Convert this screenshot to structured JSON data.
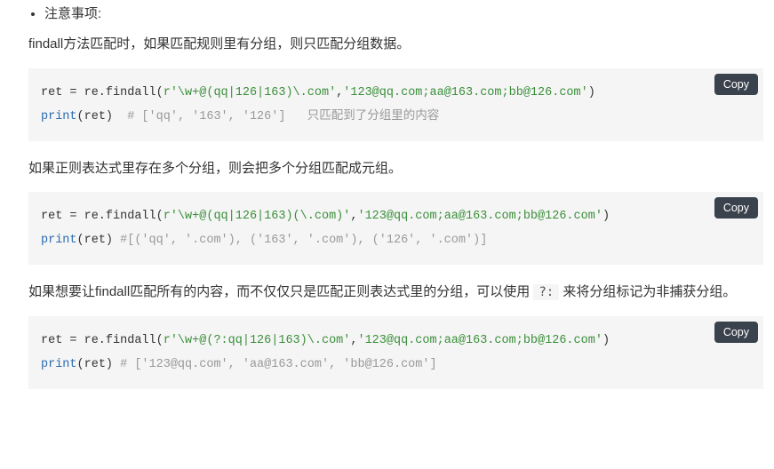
{
  "bullet": {
    "title": "注意事项:"
  },
  "para": {
    "p1": "findall方法匹配时，如果匹配规则里有分组，则只匹配分组数据。",
    "p2": "如果正则表达式里存在多个分组，则会把多个分组匹配成元组。",
    "p3a": "如果想要让findall匹配所有的内容，而不仅仅只是匹配正则表达式里的分组，可以使用 ",
    "p3b": " 来将分组标记为非捕获分组。",
    "inline_code": "?:"
  },
  "copy_label": "Copy",
  "code1": {
    "line1_a": "ret = re.findall(",
    "line1_s1": "r'\\w+@(qq|126|163)\\.com'",
    "line1_b": ",",
    "line1_s2": "'123@qq.com;aa@163.com;bb@126.com'",
    "line1_c": ")",
    "line2_a": "print",
    "line2_b": "(ret)  ",
    "line2_cmt": "# ['qq', '163', '126']   只匹配到了分组里的内容"
  },
  "code2": {
    "line1_a": "ret = re.findall(",
    "line1_s1": "r'\\w+@(qq|126|163)(\\.com)'",
    "line1_b": ",",
    "line1_s2": "'123@qq.com;aa@163.com;bb@126.com'",
    "line1_c": ")",
    "line2_a": "print",
    "line2_b": "(ret) ",
    "line2_cmt": "#[('qq', '.com'), ('163', '.com'), ('126', '.com')]"
  },
  "code3": {
    "line1_a": "ret = re.findall(",
    "line1_s1": "r'\\w+@(?:qq|126|163)\\.com'",
    "line1_b": ",",
    "line1_s2": "'123@qq.com;aa@163.com;bb@126.com'",
    "line1_c": ")",
    "line2_a": "print",
    "line2_b": "(ret) ",
    "line2_cmt": "# ['123@qq.com', 'aa@163.com', 'bb@126.com']"
  }
}
